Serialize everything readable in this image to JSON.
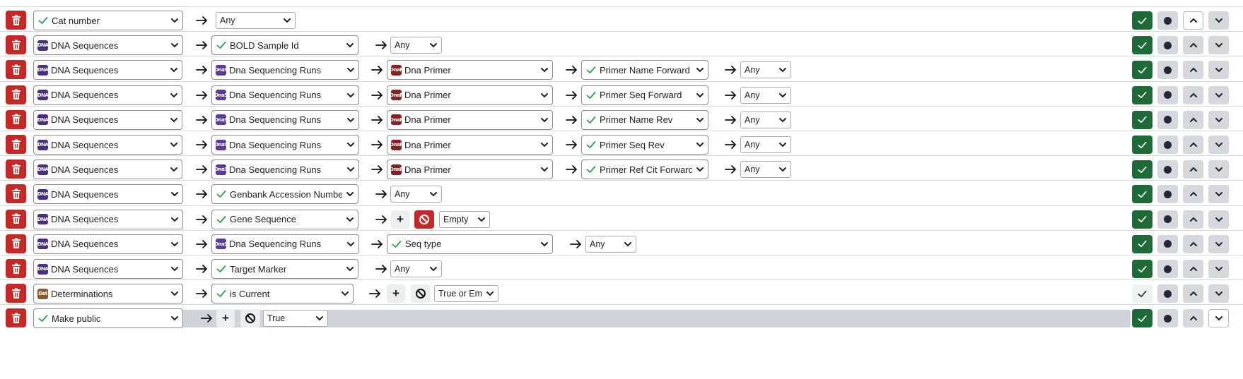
{
  "rows": [
    {
      "fields": [
        {
          "label": "Cat number",
          "icon": "check"
        }
      ],
      "value": "Any"
    },
    {
      "fields": [
        {
          "label": "DNA Sequences",
          "icon": "dna-sequences-icon"
        },
        {
          "label": "BOLD Sample Id",
          "icon": "check"
        }
      ],
      "value": "Any"
    },
    {
      "fields": [
        {
          "label": "DNA Sequences",
          "icon": "dna-sequences-icon"
        },
        {
          "label": "Dna Sequencing Runs",
          "icon": "dna-sequencing-runs-icon"
        },
        {
          "label": "Dna Primer",
          "icon": "dna-primer-icon"
        },
        {
          "label": "Primer Name Forward",
          "icon": "check"
        }
      ],
      "value": "Any"
    },
    {
      "fields": [
        {
          "label": "DNA Sequences",
          "icon": "dna-sequences-icon"
        },
        {
          "label": "Dna Sequencing Runs",
          "icon": "dna-sequencing-runs-icon"
        },
        {
          "label": "Dna Primer",
          "icon": "dna-primer-icon"
        },
        {
          "label": "Primer Seq Forward",
          "icon": "check"
        }
      ],
      "value": "Any"
    },
    {
      "fields": [
        {
          "label": "DNA Sequences",
          "icon": "dna-sequences-icon"
        },
        {
          "label": "Dna Sequencing Runs",
          "icon": "dna-sequencing-runs-icon"
        },
        {
          "label": "Dna Primer",
          "icon": "dna-primer-icon"
        },
        {
          "label": "Primer Name Rev",
          "icon": "check"
        }
      ],
      "value": "Any"
    },
    {
      "fields": [
        {
          "label": "DNA Sequences",
          "icon": "dna-sequences-icon"
        },
        {
          "label": "Dna Sequencing Runs",
          "icon": "dna-sequencing-runs-icon"
        },
        {
          "label": "Dna Primer",
          "icon": "dna-primer-icon"
        },
        {
          "label": "Primer Seq Rev",
          "icon": "check"
        }
      ],
      "value": "Any"
    },
    {
      "fields": [
        {
          "label": "DNA Sequences",
          "icon": "dna-sequences-icon"
        },
        {
          "label": "Dna Sequencing Runs",
          "icon": "dna-sequencing-runs-icon"
        },
        {
          "label": "Dna Primer",
          "icon": "dna-primer-icon"
        },
        {
          "label": "Primer Ref Cit Forward",
          "icon": "check"
        }
      ],
      "value": "Any"
    },
    {
      "fields": [
        {
          "label": "DNA Sequences",
          "icon": "dna-sequences-icon"
        },
        {
          "label": "Genbank Accession Number",
          "icon": "check"
        }
      ],
      "value": "Any"
    },
    {
      "fields": [
        {
          "label": "DNA Sequences",
          "icon": "dna-sequences-icon"
        },
        {
          "label": "Gene Sequence",
          "icon": "check"
        }
      ],
      "value": "Empty",
      "negate": true
    },
    {
      "fields": [
        {
          "label": "DNA Sequences",
          "icon": "dna-sequences-icon"
        },
        {
          "label": "Dna Sequencing Runs",
          "icon": "dna-sequencing-runs-icon"
        },
        {
          "label": "Seq type",
          "icon": "check"
        }
      ],
      "value": "Any"
    },
    {
      "fields": [
        {
          "label": "DNA Sequences",
          "icon": "dna-sequences-icon"
        },
        {
          "label": "Target Marker",
          "icon": "check"
        }
      ],
      "value": "Any"
    },
    {
      "fields": [
        {
          "label": "Determinations",
          "icon": "determinations-icon"
        },
        {
          "label": "is Current",
          "icon": "check"
        }
      ],
      "value": "True or Empty",
      "negate": false
    },
    {
      "fields": [
        {
          "label": "Make public",
          "icon": "check"
        }
      ],
      "value": "True",
      "negate": false
    }
  ],
  "icons": {
    "dna": "DNA",
    "runs": "DnaS",
    "primer": "DnaP",
    "det": "Det"
  },
  "colors": {
    "delete": "#c62828",
    "check_on": "#1e6b38",
    "check_mark": "#2e9e4f",
    "grey_button": "#d5d8dd",
    "highlight": "#d0d3d9"
  }
}
